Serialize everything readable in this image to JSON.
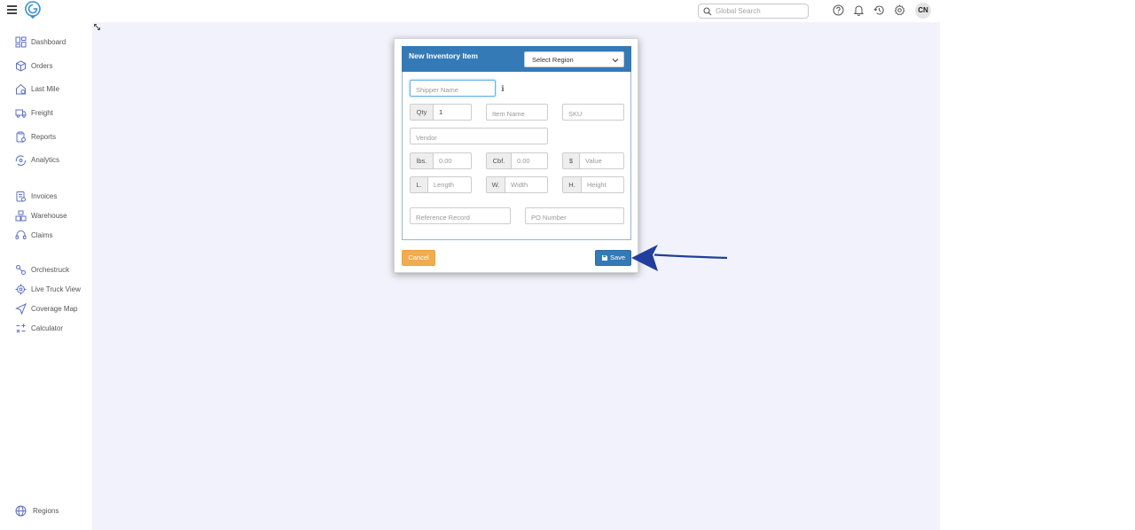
{
  "topbar": {
    "search_placeholder": "Global Search",
    "avatar_initials": "CN",
    "icons": [
      "help-icon",
      "bell-icon",
      "history-icon",
      "gear-icon"
    ]
  },
  "sidebar": {
    "items": [
      {
        "label": "Dashboard",
        "icon": "dashboard-icon"
      },
      {
        "label": "Orders",
        "icon": "box-icon"
      },
      {
        "label": "Last Mile",
        "icon": "house-icon"
      },
      {
        "label": "Freight",
        "icon": "truck-icon"
      },
      {
        "label": "Reports",
        "icon": "report-icon"
      },
      {
        "label": "Analytics",
        "icon": "analytics-icon"
      },
      {
        "label": "Invoices",
        "icon": "invoice-icon"
      },
      {
        "label": "Warehouse",
        "icon": "warehouse-icon"
      },
      {
        "label": "Claims",
        "icon": "headset-icon"
      },
      {
        "label": "Orchestruck",
        "icon": "orchestruck-icon"
      },
      {
        "label": "Live Truck View",
        "icon": "target-icon"
      },
      {
        "label": "Coverage Map",
        "icon": "navigation-icon"
      },
      {
        "label": "Calculator",
        "icon": "calculator-icon"
      }
    ],
    "footer_label": "Regions"
  },
  "modal": {
    "title": "New Inventory Item",
    "region_select": "Select Region",
    "shipper_placeholder": "Shipper Name",
    "qty_label": "Qty",
    "qty_value": "1",
    "item_name_placeholder": "Item Name",
    "sku_placeholder": "SKU",
    "vendor_placeholder": "Vendor",
    "lbs_label": "lbs.",
    "lbs_placeholder": "0.00",
    "cbf_label": "Cbf.",
    "cbf_placeholder": "0.00",
    "value_label": "$",
    "value_placeholder": "Value",
    "length_label": "L.",
    "length_placeholder": "Length",
    "width_label": "W.",
    "width_placeholder": "Width",
    "height_label": "H.",
    "height_placeholder": "Height",
    "reference_placeholder": "Reference Record",
    "po_placeholder": "PO Number",
    "cancel_label": "Cancel",
    "save_label": "Save"
  },
  "colors": {
    "primary": "#337ab7",
    "warning": "#f0ad4e",
    "content_bg": "#f1f2fb",
    "sidebar_icon": "#5b6fc7",
    "arrow": "#223e9c"
  }
}
